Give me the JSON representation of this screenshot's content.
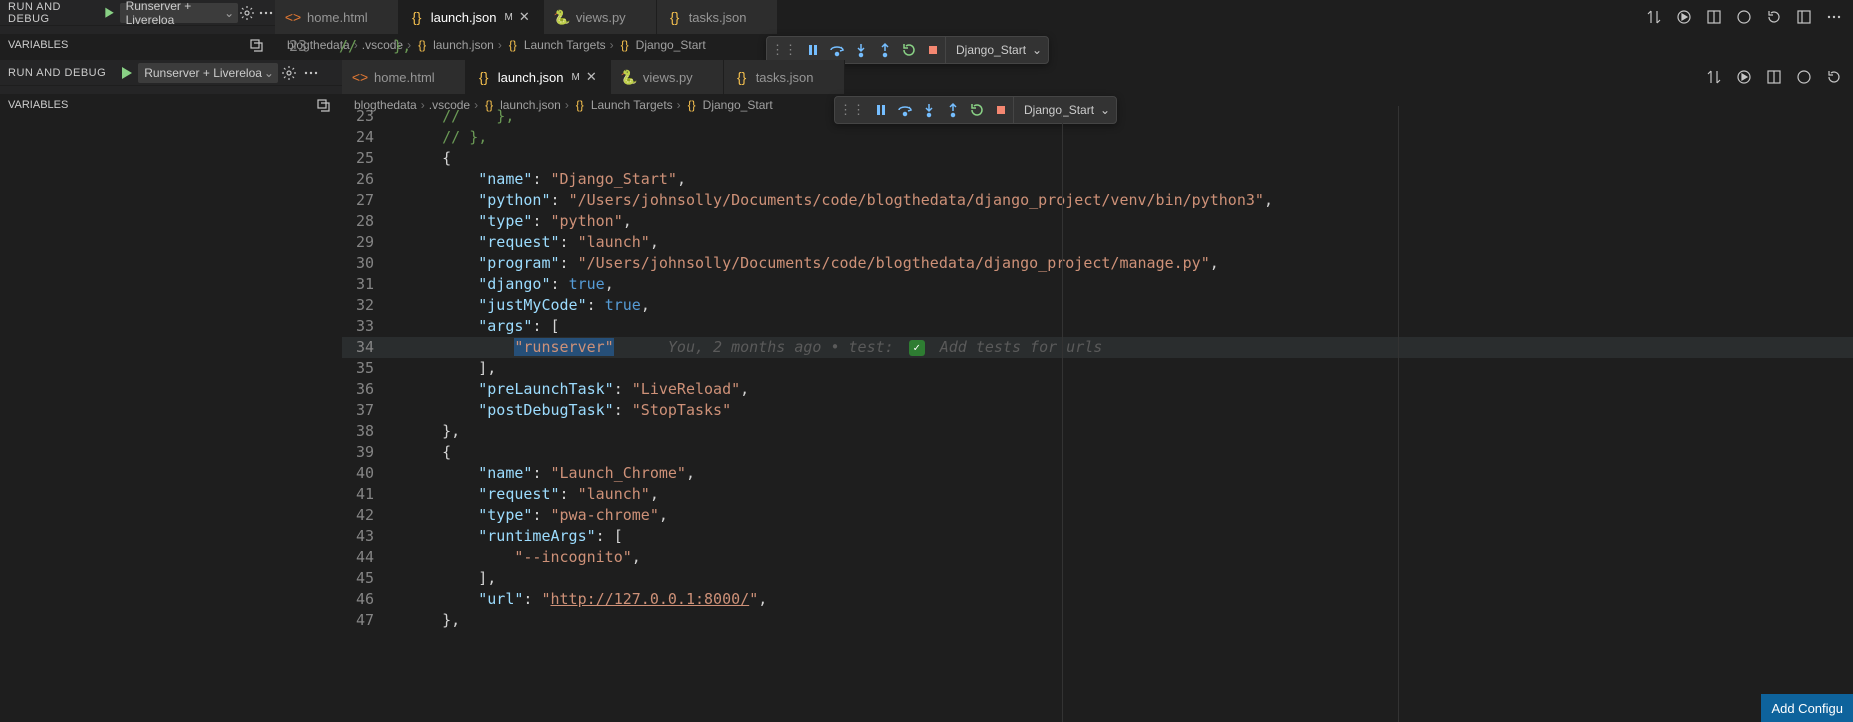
{
  "outer": {
    "run_debug_label": "RUN AND DEBUG",
    "config_name": "Runserver + Livereloa",
    "tabs": [
      {
        "icon": "html",
        "label": "home.html",
        "active": false,
        "modified": false
      },
      {
        "icon": "json",
        "label": "launch.json",
        "active": true,
        "modified": true,
        "mod_marker": "M"
      },
      {
        "icon": "py",
        "label": "views.py",
        "active": false,
        "modified": false
      },
      {
        "icon": "json",
        "label": "tasks.json",
        "active": false,
        "modified": false
      }
    ],
    "variables_label": "VARIABLES",
    "breadcrumb": [
      "blogthedata",
      ".vscode",
      "launch.json",
      "Launch Targets",
      "Django_Start"
    ],
    "debug_config": "Django_Start",
    "first_line_no": "23",
    "first_line_code": "//    },"
  },
  "inner": {
    "run_debug_label": "RUN AND DEBUG",
    "config_name": "Runserver + Livereloa",
    "tabs": [
      {
        "icon": "html",
        "label": "home.html",
        "active": false,
        "modified": false
      },
      {
        "icon": "json",
        "label": "launch.json",
        "active": true,
        "modified": true,
        "mod_marker": "M"
      },
      {
        "icon": "py",
        "label": "views.py",
        "active": false,
        "modified": false
      },
      {
        "icon": "json",
        "label": "tasks.json",
        "active": false,
        "modified": false
      }
    ],
    "variables_label": "VARIABLES",
    "breadcrumb": [
      "blogthedata",
      ".vscode",
      "launch.json",
      "Launch Targets",
      "Django_Start"
    ],
    "debug_config": "Django_Start"
  },
  "lines": [
    {
      "n": "23",
      "t": "cm",
      "txt": "//    },"
    },
    {
      "n": "24",
      "t": "cm",
      "txt": "// },"
    },
    {
      "n": "25",
      "t": "pun",
      "txt": "{"
    },
    {
      "n": "26",
      "kv": true,
      "k": "\"name\"",
      "v": "\"Django_Start\"",
      "comma": true
    },
    {
      "n": "27",
      "kv": true,
      "k": "\"python\"",
      "v": "\"/Users/johnsolly/Documents/code/blogthedata/django_project/venv/bin/python3\"",
      "comma": true
    },
    {
      "n": "28",
      "kv": true,
      "k": "\"type\"",
      "v": "\"python\"",
      "comma": true
    },
    {
      "n": "29",
      "kv": true,
      "k": "\"request\"",
      "v": "\"launch\"",
      "comma": true
    },
    {
      "n": "30",
      "kv": true,
      "k": "\"program\"",
      "v": "\"/Users/johnsolly/Documents/code/blogthedata/django_project/manage.py\"",
      "comma": true
    },
    {
      "n": "31",
      "kvkw": true,
      "k": "\"django\"",
      "v": "true",
      "comma": true
    },
    {
      "n": "32",
      "kvkw": true,
      "k": "\"justMyCode\"",
      "v": "true",
      "comma": true
    },
    {
      "n": "33",
      "open": true,
      "k": "\"args\"",
      "bracket": "["
    },
    {
      "n": "34",
      "runserver": true,
      "val": "\"runserver\"",
      "ghost_pre": "You, 2 months ago • test: ",
      "ghost_post": " Add tests for urls"
    },
    {
      "n": "35",
      "closearr": true,
      "txt": "],"
    },
    {
      "n": "36",
      "kv": true,
      "k": "\"preLaunchTask\"",
      "v": "\"LiveReload\"",
      "comma": true
    },
    {
      "n": "37",
      "kv": true,
      "k": "\"postDebugTask\"",
      "v": "\"StopTasks\"",
      "comma": false
    },
    {
      "n": "38",
      "t": "pun",
      "txt": "},",
      "dedent": true
    },
    {
      "n": "39",
      "t": "pun",
      "txt": "{",
      "dedent": true
    },
    {
      "n": "40",
      "kv": true,
      "k": "\"name\"",
      "v": "\"Launch_Chrome\"",
      "comma": true
    },
    {
      "n": "41",
      "kv": true,
      "k": "\"request\"",
      "v": "\"launch\"",
      "comma": true
    },
    {
      "n": "42",
      "kv": true,
      "k": "\"type\"",
      "v": "\"pwa-chrome\"",
      "comma": true
    },
    {
      "n": "43",
      "open": true,
      "k": "\"runtimeArgs\"",
      "bracket": "["
    },
    {
      "n": "44",
      "arritem": true,
      "val": "\"--incognito\"",
      "comma": true
    },
    {
      "n": "45",
      "closearr": true,
      "txt": "],"
    },
    {
      "n": "46",
      "kvurl": true,
      "k": "\"url\"",
      "v": "\"",
      "url": "http://127.0.0.1:8000/",
      "v2": "\"",
      "comma": true
    },
    {
      "n": "47",
      "t": "pun",
      "txt": "},",
      "dedent": true
    }
  ],
  "add_config_label": "Add Configu"
}
